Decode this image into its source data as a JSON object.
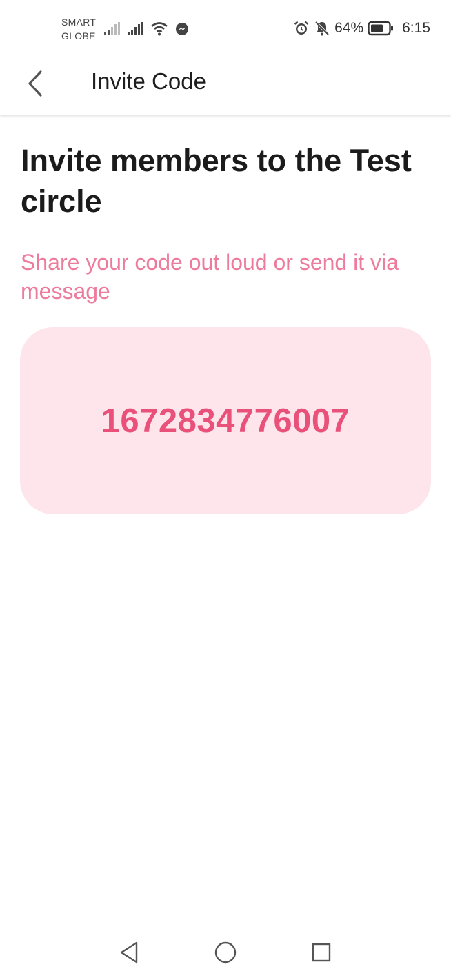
{
  "status_bar": {
    "carrier_line1": "SMART",
    "carrier_line2": "GLOBE",
    "battery_percent": "64%",
    "time": "6:15",
    "icons": [
      "signal-icon",
      "signal-icon",
      "wifi-icon",
      "messenger-icon",
      "alarm-icon",
      "bell-off-icon",
      "battery-icon"
    ]
  },
  "app_bar": {
    "back_icon": "chevron-left-icon",
    "title": "Invite Code"
  },
  "content": {
    "headline": "Invite members to the Test circle",
    "subtitle": "Share your code out loud or send it via message",
    "invite_code": "1672834776007"
  },
  "nav_bar": {
    "icons": [
      "back-triangle-icon",
      "home-circle-icon",
      "recents-square-icon"
    ]
  },
  "colors": {
    "accent": "#e9507a",
    "subtitle_pink": "#ec7b9c",
    "card_background": "#fde5eb"
  }
}
